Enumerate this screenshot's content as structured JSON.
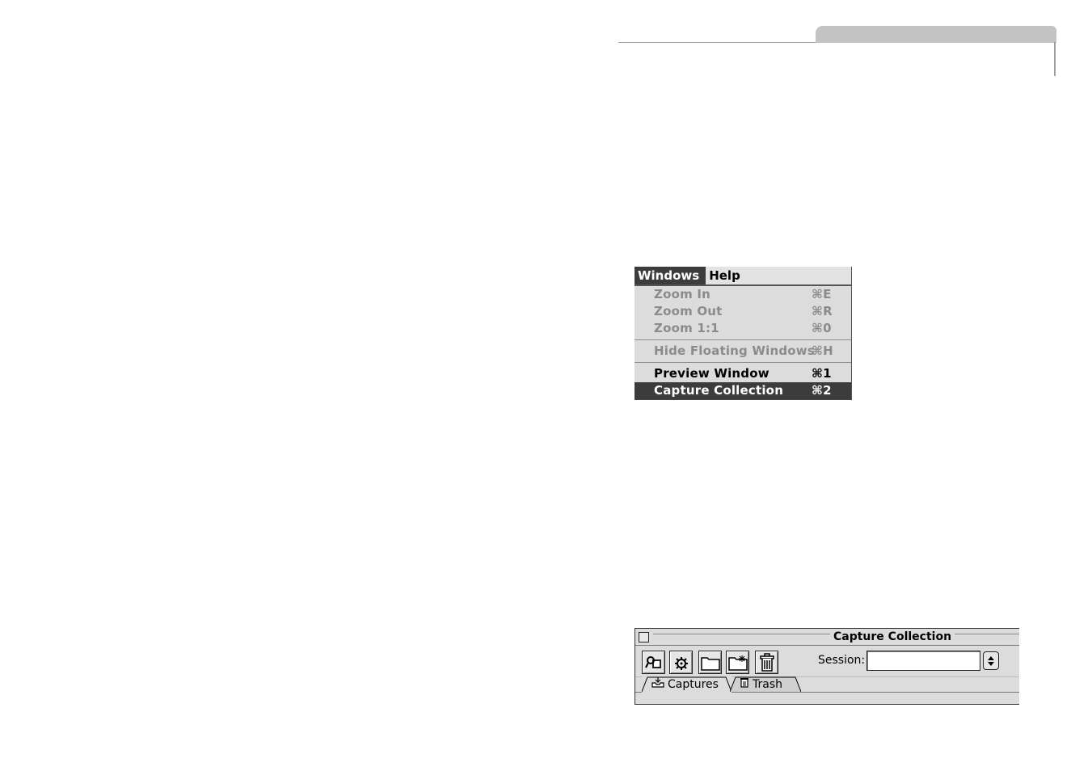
{
  "menu": {
    "bar": [
      "Windows",
      "Help"
    ],
    "items": [
      {
        "label": "Zoom In",
        "shortcut": "⌘E",
        "enabled": false
      },
      {
        "label": "Zoom Out",
        "shortcut": "⌘R",
        "enabled": false
      },
      {
        "label": "Zoom 1:1",
        "shortcut": "⌘0",
        "enabled": false
      },
      {
        "label": "Hide Floating Windows",
        "shortcut": "⌘H",
        "enabled": false
      },
      {
        "label": "Preview Window",
        "shortcut": "⌘1",
        "enabled": true
      },
      {
        "label": "Capture Collection",
        "shortcut": "⌘2",
        "enabled": true,
        "selected": true
      }
    ]
  },
  "window": {
    "title": "Capture Collection",
    "toolbar": {
      "buttons": [
        "capture-icon",
        "settings-gear-icon",
        "folder-icon",
        "new-folder-icon",
        "trash-icon"
      ]
    },
    "session": {
      "label": "Session:",
      "value": ""
    },
    "tabs": [
      {
        "label": "Captures",
        "icon": "captures-tray-icon"
      },
      {
        "label": "Trash",
        "icon": "trash-icon"
      }
    ]
  },
  "colors": {
    "menu_highlight": "#3c3c3c",
    "menu_disabled_text": "#8b8b8b",
    "window_bg": "#dcdcdc",
    "page_tab": "#c3c3c3"
  }
}
